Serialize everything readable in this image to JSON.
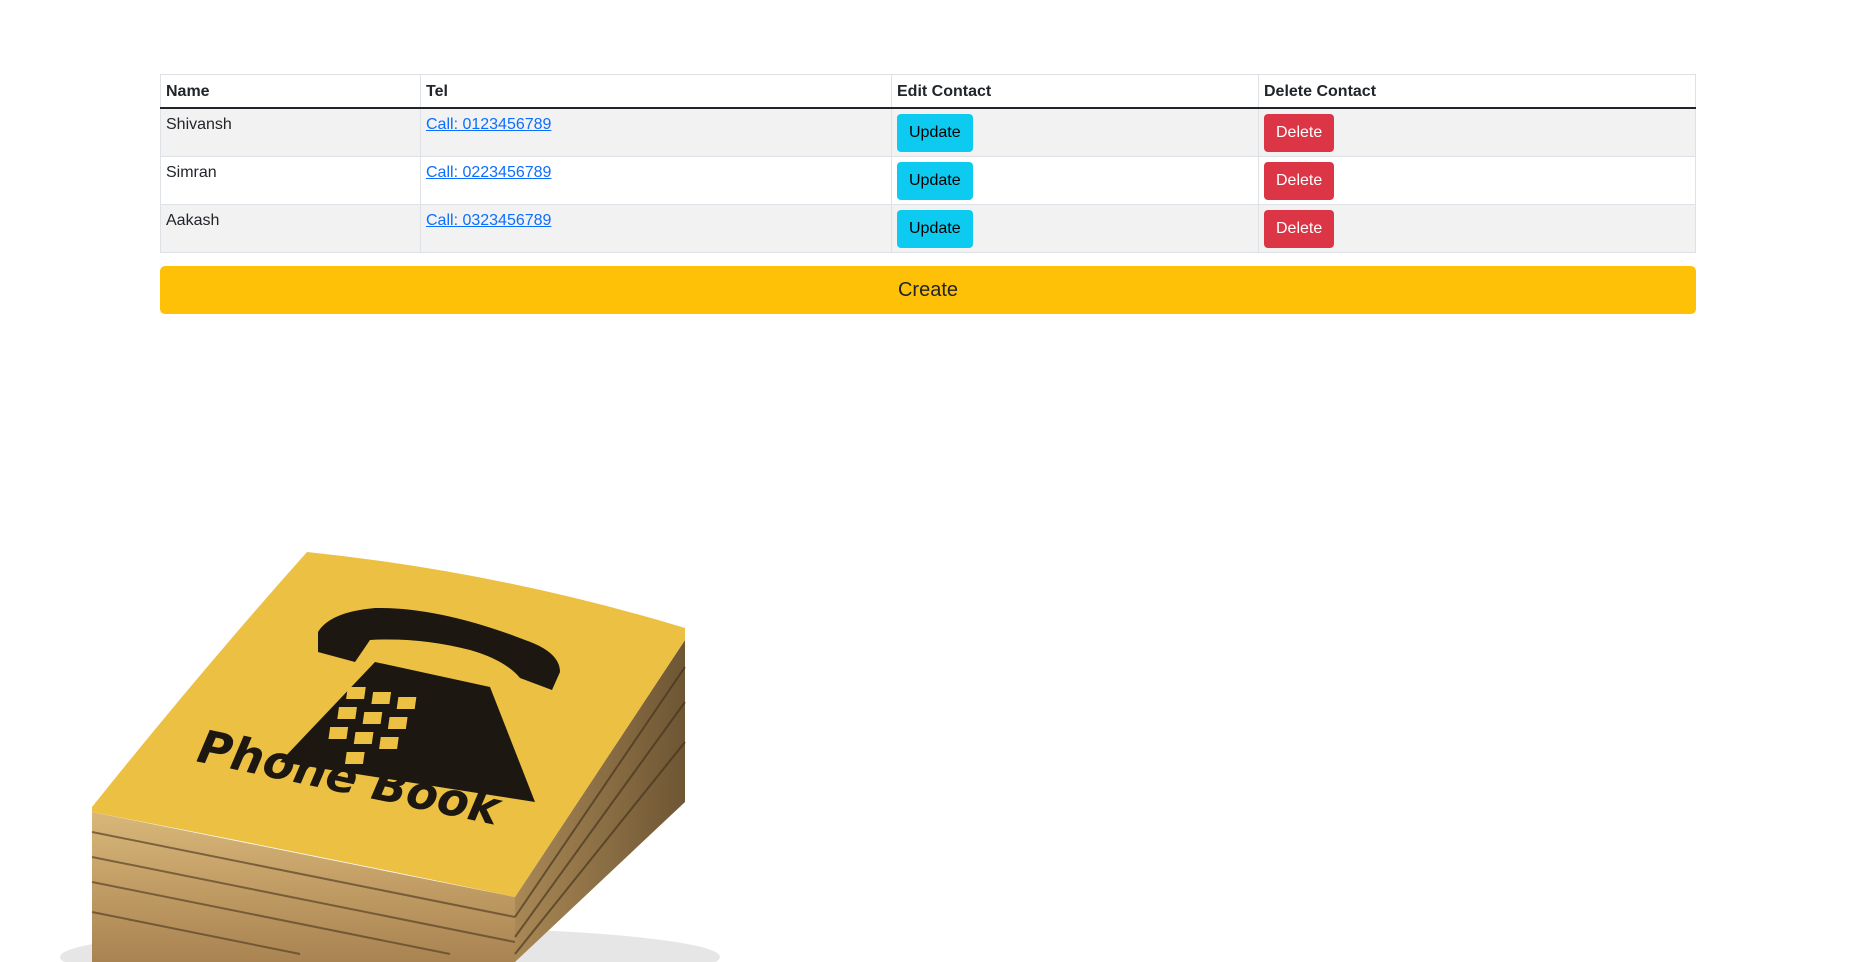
{
  "table": {
    "headers": [
      "Name",
      "Tel",
      "Edit Contact",
      "Delete Contact"
    ],
    "rows": [
      {
        "name": "Shivansh",
        "tel": "Call: 0123456789",
        "update": "Update",
        "delete": "Delete"
      },
      {
        "name": "Simran",
        "tel": "Call: 0223456789",
        "update": "Update",
        "delete": "Delete"
      },
      {
        "name": "Aakash",
        "tel": "Call: 0323456789",
        "update": "Update",
        "delete": "Delete"
      }
    ]
  },
  "create_label": "Create",
  "image": {
    "name": "phone-book-illustration",
    "cover_text": "Phone Book",
    "cover_color": "#ecc042",
    "pages_color": "#c9a46a"
  },
  "colors": {
    "update": "#0dcaf0",
    "delete": "#dc3545",
    "create": "#ffc107",
    "link": "#0d6efd"
  }
}
